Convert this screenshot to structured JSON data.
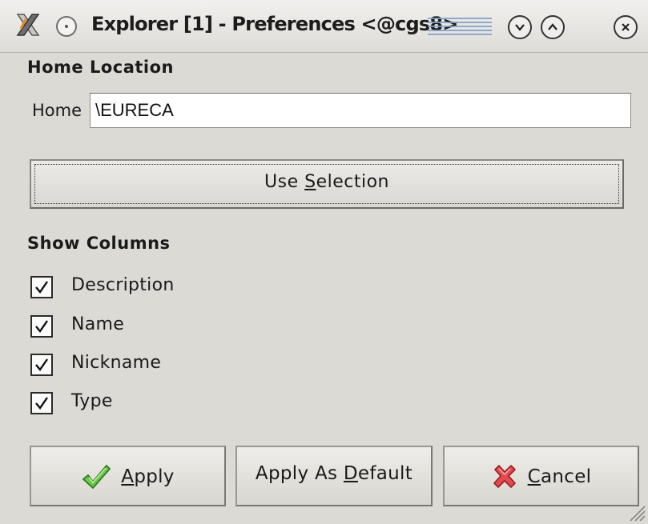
{
  "window": {
    "title": "Explorer [1] - Preferences <@cgs8>",
    "icons": [
      "app-x-icon",
      "window-menu-icon",
      "minimize-icon",
      "maximize-icon",
      "close-icon"
    ]
  },
  "home_section": {
    "heading": "Home Location",
    "label": "Home",
    "value": "\\EURECA",
    "use_selection_button": {
      "before": "Use ",
      "mnemonic": "S",
      "after": "election"
    }
  },
  "columns_section": {
    "heading": "Show Columns",
    "items": [
      {
        "label": "Description",
        "checked": true
      },
      {
        "label": "Name",
        "checked": true
      },
      {
        "label": "Nickname",
        "checked": true
      },
      {
        "label": "Type",
        "checked": true
      }
    ]
  },
  "buttons": {
    "apply": {
      "mnemonic": "A",
      "rest": "pply",
      "icon": "checkmark-icon"
    },
    "apply_default": {
      "before": "Apply As ",
      "mnemonic": "D",
      "rest": "efault"
    },
    "cancel": {
      "mnemonic": "C",
      "rest": "ancel",
      "icon": "red-x-icon"
    }
  },
  "colors": {
    "window_bg": "#dcdad5",
    "apply_icon": "#58b93a",
    "cancel_icon": "#d8363c"
  }
}
